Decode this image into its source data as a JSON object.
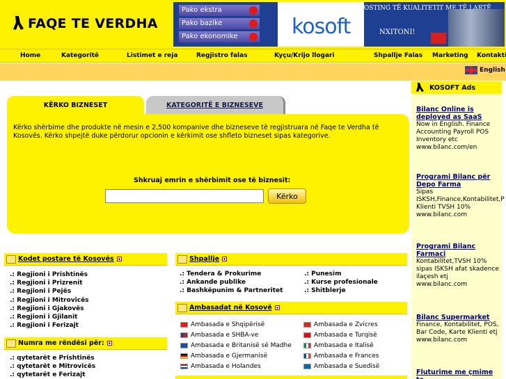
{
  "header": {
    "logo_text": "FAQE TE VERDHA",
    "banner": {
      "packs": [
        "Pako ekstra",
        "Pako bazike",
        "Pako ekonomike"
      ],
      "brand": "kosoft",
      "tagline": "HOSTING TË KUALITETIT ME TË LARTË",
      "cta": "NXITONI!"
    }
  },
  "nav": {
    "items": [
      "Home",
      "Kategoritë",
      "Listimet e reja",
      "Regjistro falas",
      "Kyçu/Krijo llogari",
      "Shpallje Falas",
      "Marketing",
      "Kontakti"
    ]
  },
  "lang": {
    "label": "English"
  },
  "search": {
    "tab_active": "KËRKO BIZNESET",
    "tab_inactive": "KATEGORITË E BIZNESEVE",
    "description": "Kërko shërbime dhe produkte në mesin e 2,500 kompanive dhe bizneseve të regjistruara në Faqe te Verdha të Kosovës. Kërko shpejtë duke përdorur opcionin e kërkimit ose shfleto bizneset sipas kategorive.",
    "label": "Shkruaj emrin e shërbimit ose të biznesit:",
    "input_value": "",
    "button": "Kërko"
  },
  "postal": {
    "title": "Kodet postare të Kosovës",
    "items": [
      ".: Regjioni i Prishtinës",
      ".: Regjioni i Prizrenit",
      ".: Regjioni i Pejës",
      ".: Regjioni i Mitrovicës",
      ".: Regjioni i Gjakovës",
      ".: Regjioni i Gjilanit",
      ".: Regjioni i Ferizajt"
    ]
  },
  "emergency": {
    "title": "Numra me rëndësi për:",
    "items": [
      ".: qytetarët e Prishtinës",
      ".: qytetarët e Mitrovicës",
      ".: qytetarët e Ferizajt"
    ]
  },
  "ads": {
    "title": "Shpallje",
    "left": [
      ".: Tendera & Prokurime",
      ".: Ankande publike",
      ".: Bashkëpunim & Partneritet"
    ],
    "right": [
      ".: Punesim",
      ".: Kurse profesionale",
      ".: Shitblerje"
    ]
  },
  "embassies": {
    "title": "Ambasadat në Kosovë",
    "left": [
      "Ambasada e Shqipërisë",
      "Ambasada e SHBA-ve",
      "Ambasada e Britanisë së Madhe",
      "Ambasada e Gjermanisë",
      "Ambasada e Holandes"
    ],
    "right": [
      "Ambasada e Zvicres",
      "Ambasada e Turqisë",
      "Ambasada e Italisë",
      "Ambasada e Frances",
      "Ambasada e Suedisë"
    ]
  },
  "sidebar": {
    "title": "KOSOFT Ads",
    "ads": [
      {
        "title": "Bilanc Online is deployed as SaaS",
        "body": "Now in English. Finance Accounting Payroll POS Inventory etc",
        "url": "www.bilanc.com/en"
      },
      {
        "title": "Programi Bilanc për Depo Farma",
        "body": "Sipas ISKSH,Finance,Kontabilitet,P Klienti TVSH 10%",
        "url": "www.bilanc.com"
      },
      {
        "title": "Programi Bilanc Farmaci",
        "body": "Kontabilitet,TVSH 10% sipas ISKSH afat skadence ilaçesh etj",
        "url": "www.bilanc.com"
      },
      {
        "title": "Bilanc Supermarket",
        "body": "Finance, Kontabilitet, POS, Bar Code, Karte Klienti etj",
        "url": "www.bilanc.com"
      },
      {
        "title": "Fluturime me çmime te",
        "body": "",
        "url": ""
      }
    ]
  },
  "colors": {
    "brand_yellow": "#fff200",
    "subbar": "#ffd55e",
    "sidebar_bg": "#ffffcc",
    "banner_blue": "#1f3f92"
  }
}
